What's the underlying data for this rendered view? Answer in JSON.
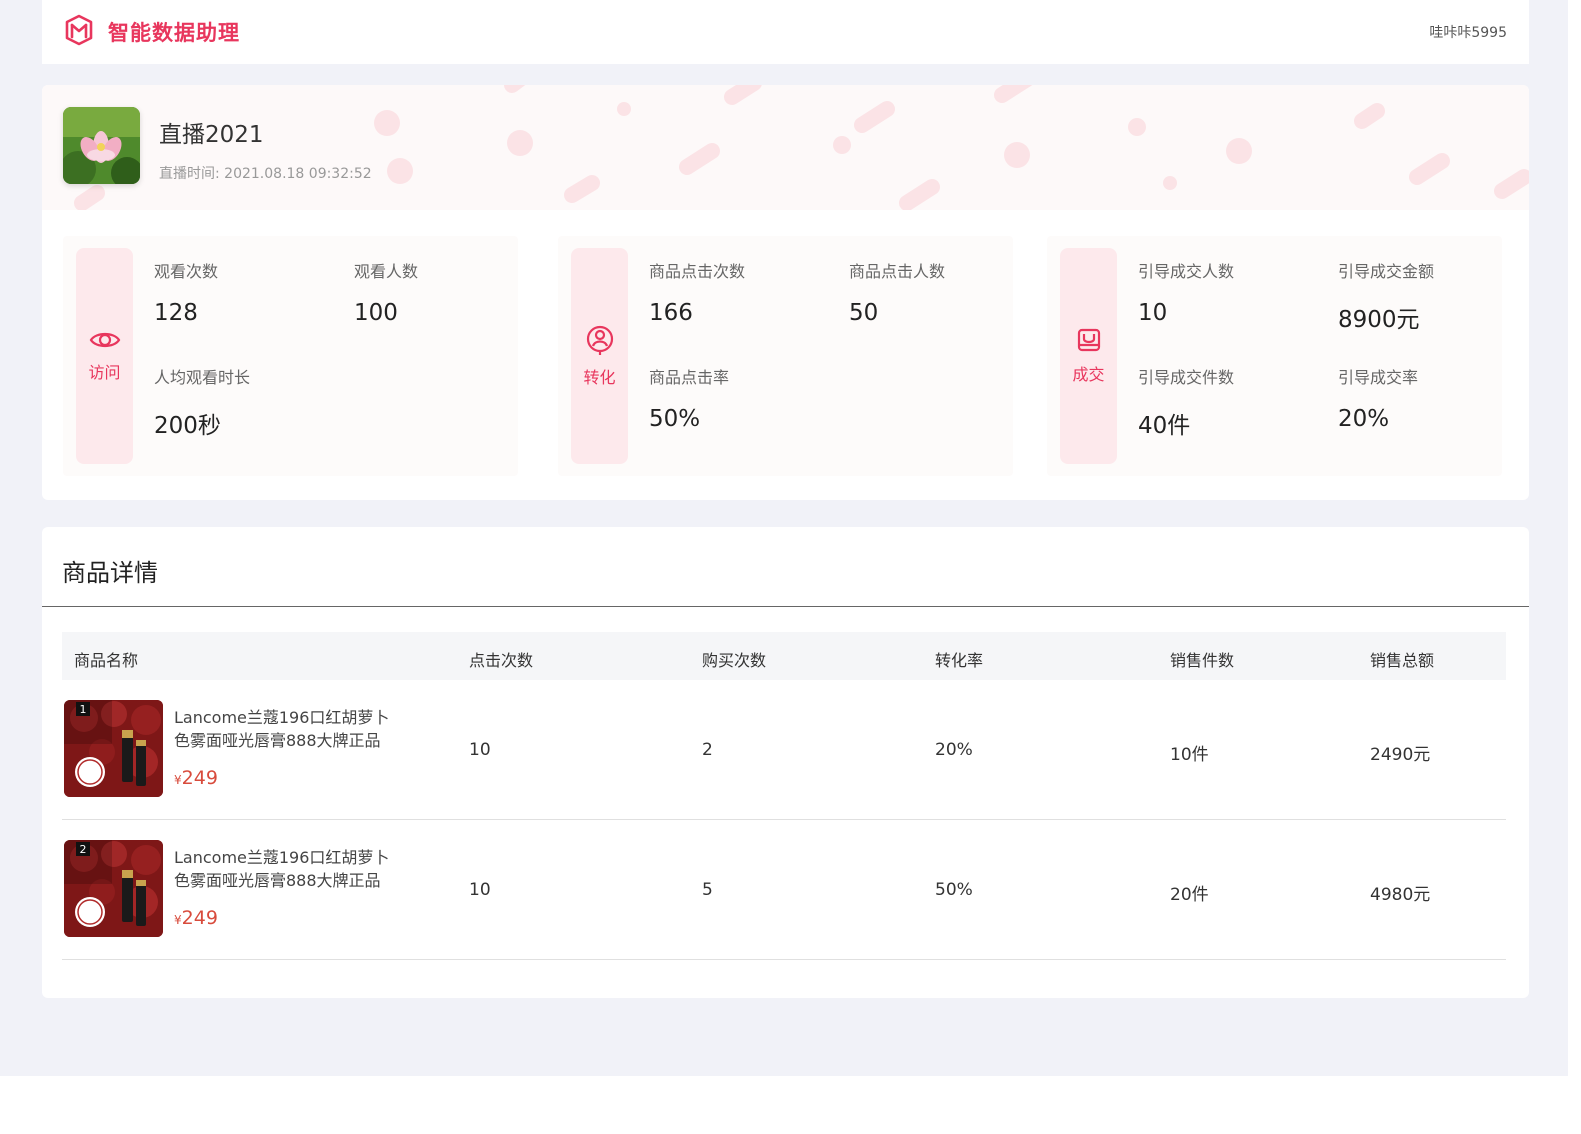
{
  "app": {
    "brand_name": "智能数据助理",
    "user_name": "哇咔咔5995",
    "accent_color": "#e8365d"
  },
  "live": {
    "title": "直播2021",
    "time_label": "直播时间:",
    "time_value": "2021.08.18 09:32:52",
    "cover_icon": "lotus-image"
  },
  "stats": {
    "visit": {
      "tag": "访问",
      "icon": "eye-icon",
      "metrics": [
        {
          "label": "观看次数",
          "value": "128"
        },
        {
          "label": "观看人数",
          "value": "100"
        },
        {
          "label": "人均观看时长",
          "value": "200秒"
        }
      ]
    },
    "conversion": {
      "tag": "转化",
      "icon": "user-circle-icon",
      "metrics": [
        {
          "label": "商品点击次数",
          "value": "166"
        },
        {
          "label": "商品点击人数",
          "value": "50"
        },
        {
          "label": "商品点击率",
          "value": "50%"
        }
      ]
    },
    "deal": {
      "tag": "成交",
      "icon": "bag-icon",
      "metrics": [
        {
          "label": "引导成交人数",
          "value": "10"
        },
        {
          "label": "引导成交金额",
          "value": "8900元"
        },
        {
          "label": "引导成交件数",
          "value": "40件"
        },
        {
          "label": "引导成交率",
          "value": "20%"
        }
      ]
    }
  },
  "products": {
    "title": "商品详情",
    "columns": [
      "商品名称",
      "点击次数",
      "购买次数",
      "转化率",
      "销售件数",
      "销售总额"
    ],
    "rows": [
      {
        "rank": "1",
        "name": "Lancome兰蔻196口红胡萝卜色雾面哑光唇膏888大牌正品",
        "price_symbol": "¥",
        "price": "249",
        "clicks": "10",
        "purchases": "2",
        "conversion": "20%",
        "units": "10件",
        "total": "2490元"
      },
      {
        "rank": "2",
        "name": "Lancome兰蔻196口红胡萝卜色雾面哑光唇膏888大牌正品",
        "price_symbol": "¥",
        "price": "249",
        "clicks": "10",
        "purchases": "5",
        "conversion": "50%",
        "units": "20件",
        "total": "4980元"
      }
    ]
  }
}
